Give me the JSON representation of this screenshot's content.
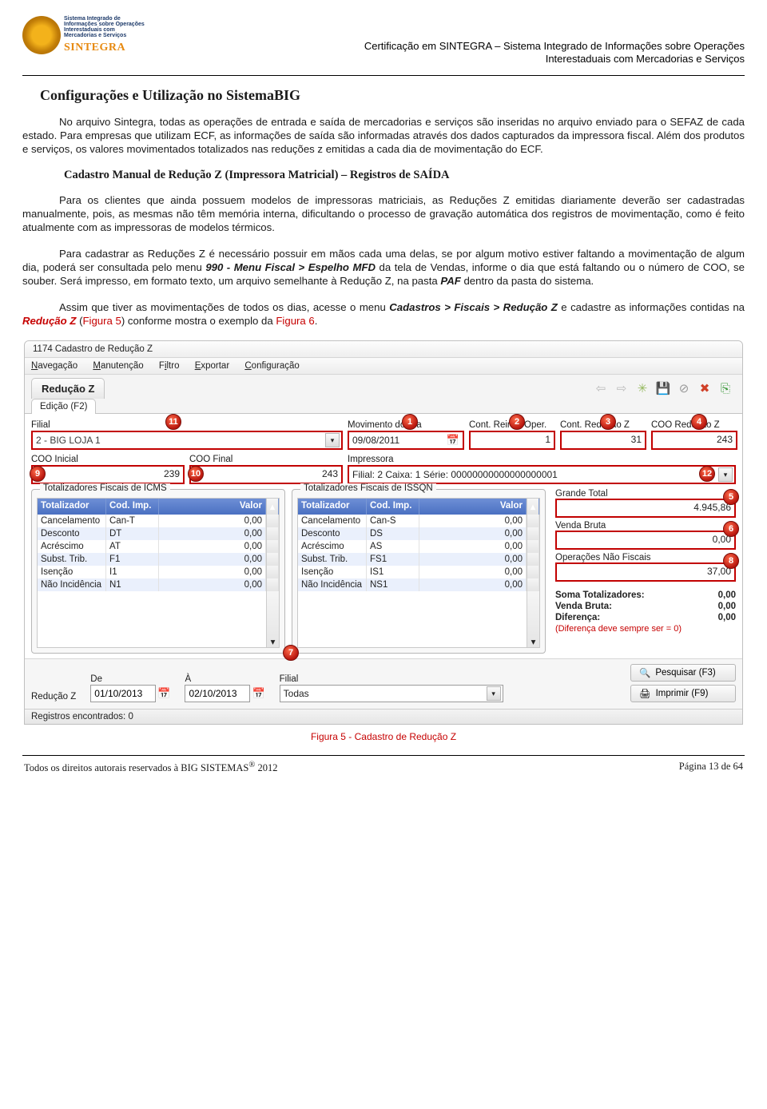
{
  "header": {
    "logo_small_text": "Sistema Integrado de Informações sobre Operações Interestaduais com Mercadorias e Serviços",
    "brand": "SINTEGRA",
    "right_line1": "Certificação em SINTEGRA – Sistema Integrado de Informações sobre Operações",
    "right_line2": "Interestaduais com Mercadorias e Serviços"
  },
  "section_title": "Configurações e Utilização no SistemaBIG",
  "para1": "No arquivo Sintegra, todas as operações de entrada e saída de mercadorias e serviços são inseridas no arquivo enviado para o SEFAZ de cada estado. Para empresas que utilizam ECF, as informações de saída são informadas através dos dados capturados da impressora fiscal. Além dos produtos e serviços, os valores movimentados totalizados nas reduções z emitidas a cada dia de movimentação do ECF.",
  "subheading": "Cadastro Manual de Redução Z (Impressora Matricial) – Registros de SAÍDA",
  "para2": "Para os clientes que ainda possuem modelos de impressoras matriciais, as Reduções Z emitidas diariamente deverão ser cadastradas manualmente, pois, as mesmas não têm memória interna, dificultando o processo de gravação automática dos registros de movimentação, como é feito atualmente com as impressoras de modelos térmicos.",
  "para3_a": "Para cadastrar as Reduções Z é necessário possuir em mãos cada uma delas, se por algum motivo estiver faltando a movimentação de algum dia, poderá ser consultada pelo menu ",
  "para3_b": "990 - Menu Fiscal > Espelho MFD",
  "para3_c": " da tela de Vendas, informe o dia que está faltando ou o número de COO, se souber. Será impresso, em formato texto, um arquivo semelhante à Redução Z, na pasta ",
  "para3_d": "PAF",
  "para3_e": " dentro da pasta do sistema.",
  "para4_a": "Assim que tiver as movimentações de todos os dias, acesse o menu ",
  "para4_b": "Cadastros > Fiscais > Redução Z",
  "para4_c": " e cadastre as informações contidas na ",
  "para4_d": "Redução Z",
  "para4_e": " (",
  "para4_f": "Figura 5",
  "para4_g": ") conforme mostra o exemplo da  ",
  "para4_h": "Figura 6",
  "para4_i": ".",
  "app": {
    "title": "1174 Cadastro de Redução Z",
    "menu": {
      "nav": "Navegação",
      "man": "Manutenção",
      "fil": "Filtro",
      "exp": "Exportar",
      "cfg": "Configuração"
    },
    "module_tab": "Redução Z",
    "edition_tab": "Edição (F2)",
    "fields": {
      "filial_label": "Filial",
      "filial_value": "2 - BIG LOJA 1",
      "mov_dia_label": "Movimento do Dia",
      "mov_dia_value": "09/08/2011",
      "cro_label": "Cont. Reinic. Oper.",
      "cro_value": "1",
      "crz_label": "Cont. Redução Z",
      "crz_value": "31",
      "coo_rz_label": "COO Redução Z",
      "coo_rz_value": "243",
      "coo_ini_label": "COO Inicial",
      "coo_ini_value": "239",
      "coo_fin_label": "COO Final",
      "coo_fin_value": "243",
      "impressora_label": "Impressora",
      "impressora_value": "Filial: 2 Caixa: 1 Série: 00000000000000000001"
    },
    "grid_headers": {
      "tot": "Totalizador",
      "cod": "Cod. Imp.",
      "val": "Valor"
    },
    "icms_title": "Totalizadores Fiscais de ICMS",
    "icms_rows": [
      {
        "t": "Cancelamento",
        "c": "Can-T",
        "v": "0,00"
      },
      {
        "t": "Desconto",
        "c": "DT",
        "v": "0,00"
      },
      {
        "t": "Acréscimo",
        "c": "AT",
        "v": "0,00"
      },
      {
        "t": "Subst. Trib.",
        "c": "F1",
        "v": "0,00"
      },
      {
        "t": "Isenção",
        "c": "I1",
        "v": "0,00"
      },
      {
        "t": "Não Incidência",
        "c": "N1",
        "v": "0,00"
      }
    ],
    "issqn_title": "Totalizadores Fiscais de ISSQN",
    "issqn_rows": [
      {
        "t": "Cancelamento",
        "c": "Can-S",
        "v": "0,00"
      },
      {
        "t": "Desconto",
        "c": "DS",
        "v": "0,00"
      },
      {
        "t": "Acréscimo",
        "c": "AS",
        "v": "0,00"
      },
      {
        "t": "Subst. Trib.",
        "c": "FS1",
        "v": "0,00"
      },
      {
        "t": "Isenção",
        "c": "IS1",
        "v": "0,00"
      },
      {
        "t": "Não Incidência",
        "c": "NS1",
        "v": "0,00"
      }
    ],
    "right": {
      "gt_label": "Grande Total",
      "gt_value": "4.945,86",
      "vb_label": "Venda Bruta",
      "vb_value": "0,00",
      "onf_label": "Operações Não Fiscais",
      "onf_value": "37,00",
      "sum_tot_label": "Soma Totalizadores:",
      "sum_tot_val": "0,00",
      "sum_vb_label": "Venda Bruta:",
      "sum_vb_val": "0,00",
      "sum_dif_label": "Diferença:",
      "sum_dif_val": "0,00",
      "warn": "(Diferença deve sempre ser = 0)"
    },
    "filter": {
      "rz_label": "Redução Z",
      "de_label": "De",
      "de_value": "01/10/2013",
      "a_label": "À",
      "a_value": "02/10/2013",
      "filial_label": "Filial",
      "filial_value": "Todas",
      "search_btn": "Pesquisar (F3)",
      "print_btn": "Imprimir (F9)"
    },
    "status": "Registros encontrados: 0"
  },
  "figure_caption": "Figura 5 - Cadastro de Redução Z",
  "footer": {
    "left_a": "Todos os direitos autorais reservados à BIG SISTEMAS",
    "left_b": "®",
    "left_c": " 2012",
    "right": "Página  13 de 64"
  }
}
